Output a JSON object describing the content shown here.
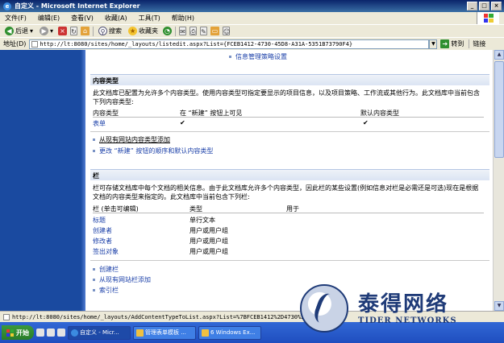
{
  "window": {
    "title": "自定义 - Microsoft Internet Explorer",
    "buttons": [
      "_",
      "□",
      "×"
    ]
  },
  "menu": [
    "文件(F)",
    "编辑(E)",
    "查看(V)",
    "收藏(A)",
    "工具(T)",
    "帮助(H)"
  ],
  "toolbar": {
    "back": "后退",
    "search": "搜索",
    "favorites": "收藏夹"
  },
  "address": {
    "label": "地址(D)",
    "url": "http://lt:8080/sites/home/_layouts/listedit.aspx?List={FCEB1412-4730-45D8-A31A-5351B73790F4}",
    "go": "转到",
    "links": "链接"
  },
  "content": {
    "top_link": "信息管理策略设置",
    "content_types": {
      "heading": "内容类型",
      "description": "此文档库已配置为允许多个内容类型。使用内容类型可指定要显示的项目信息，以及项目策略、工作流或其他行为。此文档库中当前包含下列内容类型:",
      "headers": [
        "内容类型",
        "在 “新建” 按钮上可见",
        "默认内容类型"
      ],
      "rows": [
        {
          "name": "表单",
          "visible": "✔",
          "default": "✔"
        }
      ],
      "links": [
        "从现有网站内容类型添加",
        "更改 “新建” 按钮的顺序和默认内容类型"
      ]
    },
    "columns": {
      "heading": "栏",
      "description": "栏可存储文档库中每个文档的相关信息。由于此文档库允许多个内容类型，因此栏的某些设置(例如信息对栏是必需还是可选)现在是根据文档的内容类型来指定的。此文档库中当前包含下列栏:",
      "headers": [
        "栏 (单击可编辑)",
        "类型",
        "用于"
      ],
      "rows": [
        {
          "name": "标题",
          "type": "单行文本"
        },
        {
          "name": "创建者",
          "type": "用户或用户组"
        },
        {
          "name": "修改者",
          "type": "用户或用户组"
        },
        {
          "name": "签出对象",
          "type": "用户或用户组"
        }
      ],
      "links": [
        "创建栏",
        "从现有网站栏添加",
        "索引栏"
      ]
    }
  },
  "statusbar": {
    "text": "http://lt:8080/sites/home/_layouts/AddContentTypeToList.aspx?List=%7BFCEB1412%2D4730%2D4"
  },
  "taskbar": {
    "start": "开始",
    "tasks": [
      "自定义 - Micr...",
      "管理表单模板 ...",
      "6 Windows Ex..."
    ]
  },
  "watermark": {
    "cn": "泰得网络",
    "en": "TIDER NETWORKS"
  },
  "colors": {
    "nav": "#1a4aa0",
    "link": "#1a3fa8",
    "brand": "#1f3b78"
  }
}
